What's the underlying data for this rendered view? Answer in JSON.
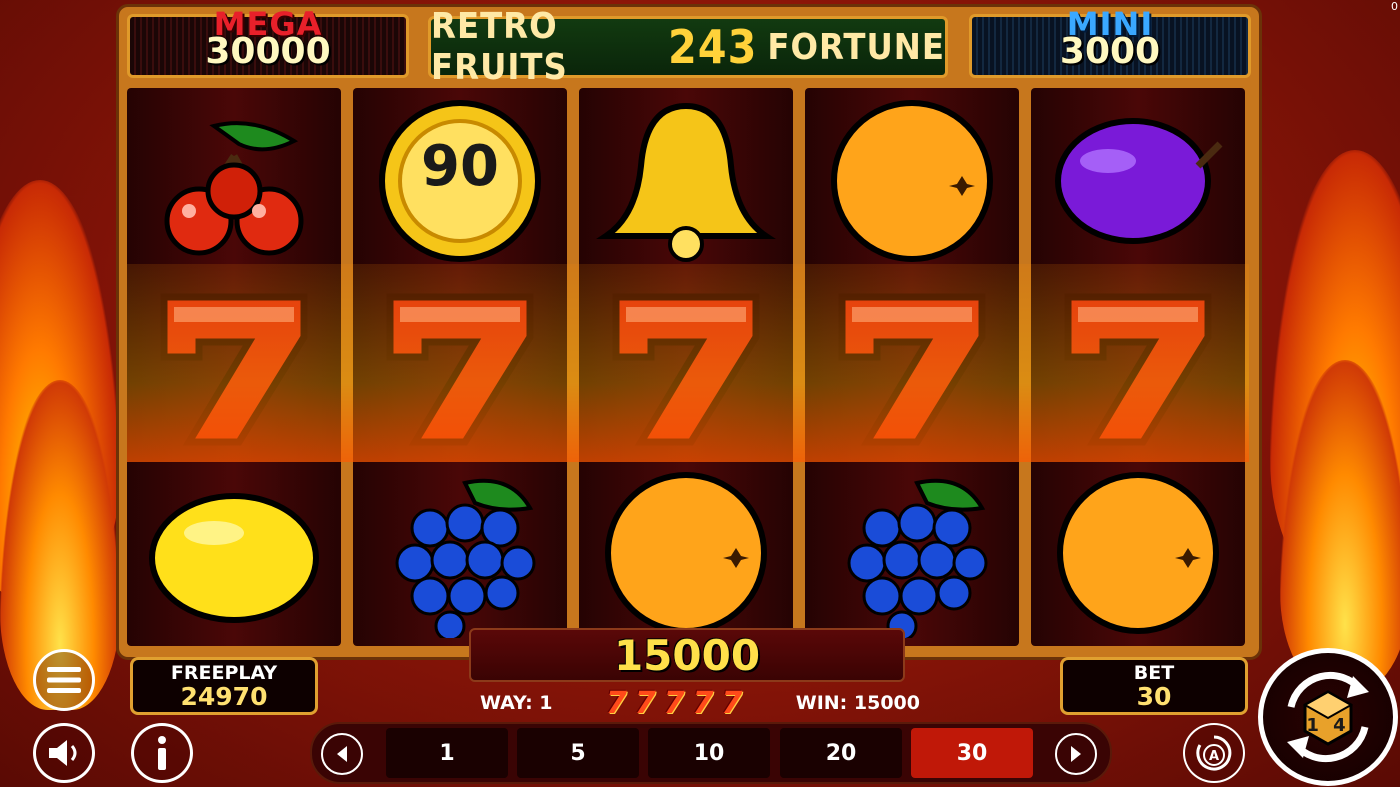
{
  "jackpots": {
    "mega": {
      "label": "MEGA",
      "value": "30000",
      "label_color": "#e8202a"
    },
    "mini": {
      "label": "MINI",
      "value": "3000",
      "label_color": "#3aa8ff"
    }
  },
  "title": {
    "part1": "RETRO FRUITS",
    "number": "243",
    "part2": "FORTUNE"
  },
  "reels": [
    [
      "cherries",
      "seven",
      "lemon"
    ],
    [
      "coin-90",
      "seven",
      "grapes"
    ],
    [
      "bell",
      "seven",
      "orange"
    ],
    [
      "orange",
      "seven",
      "grapes"
    ],
    [
      "plum",
      "seven",
      "orange"
    ]
  ],
  "coin_value": "90",
  "freeplay": {
    "label": "FREEPLAY",
    "value": "24970"
  },
  "bet": {
    "label": "BET",
    "value": "30"
  },
  "win_amount": "15000",
  "way": {
    "label": "WAY: 1",
    "win": "WIN: 15000"
  },
  "bet_options": [
    "1",
    "5",
    "10",
    "20",
    "30"
  ],
  "selected_bet_index": 4,
  "corner_text": "0",
  "logo_text": "1 4"
}
